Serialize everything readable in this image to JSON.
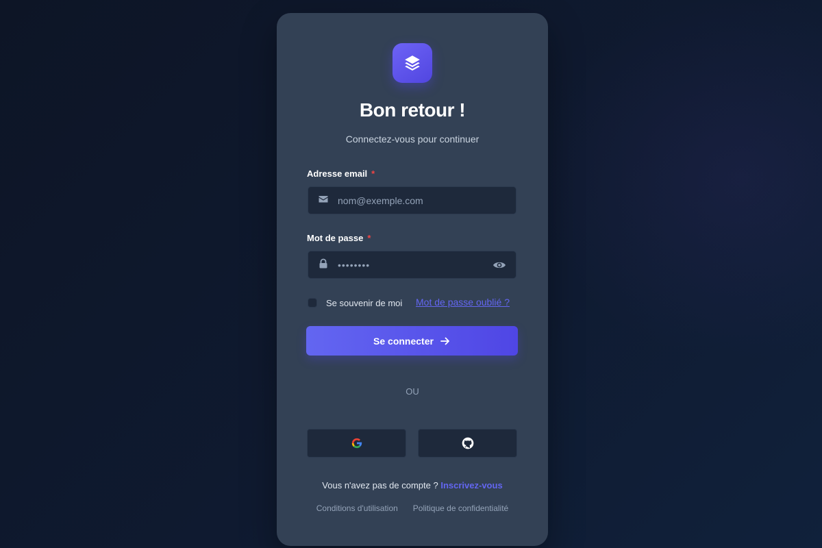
{
  "login": {
    "title": "Bon retour !",
    "subtitle": "Connectez-vous pour continuer",
    "email": {
      "label": "Adresse email",
      "required_marker": "*",
      "placeholder": "nom@exemple.com"
    },
    "password": {
      "label": "Mot de passe",
      "required_marker": "*",
      "value": "••••••••"
    },
    "remember_label": "Se souvenir de moi",
    "forgot_label": "Mot de passe oublié ?",
    "submit_label": "Se connecter",
    "divider_label": "OU",
    "signup_prompt": "Vous n'avez pas de compte ?",
    "signup_link": "Inscrivez-vous",
    "terms_link": "Conditions d'utilisation",
    "privacy_link": "Politique de confidentialité"
  },
  "icons": {
    "logo": "layers-icon",
    "email": "envelope-icon",
    "password": "lock-icon",
    "toggle_visibility": "eye-icon",
    "submit": "arrow-right-icon",
    "google": "google-icon",
    "github": "github-icon"
  },
  "colors": {
    "accent": "#6366f1",
    "card": "#334155",
    "input_bg": "#1e293b",
    "required": "#ef4444"
  }
}
